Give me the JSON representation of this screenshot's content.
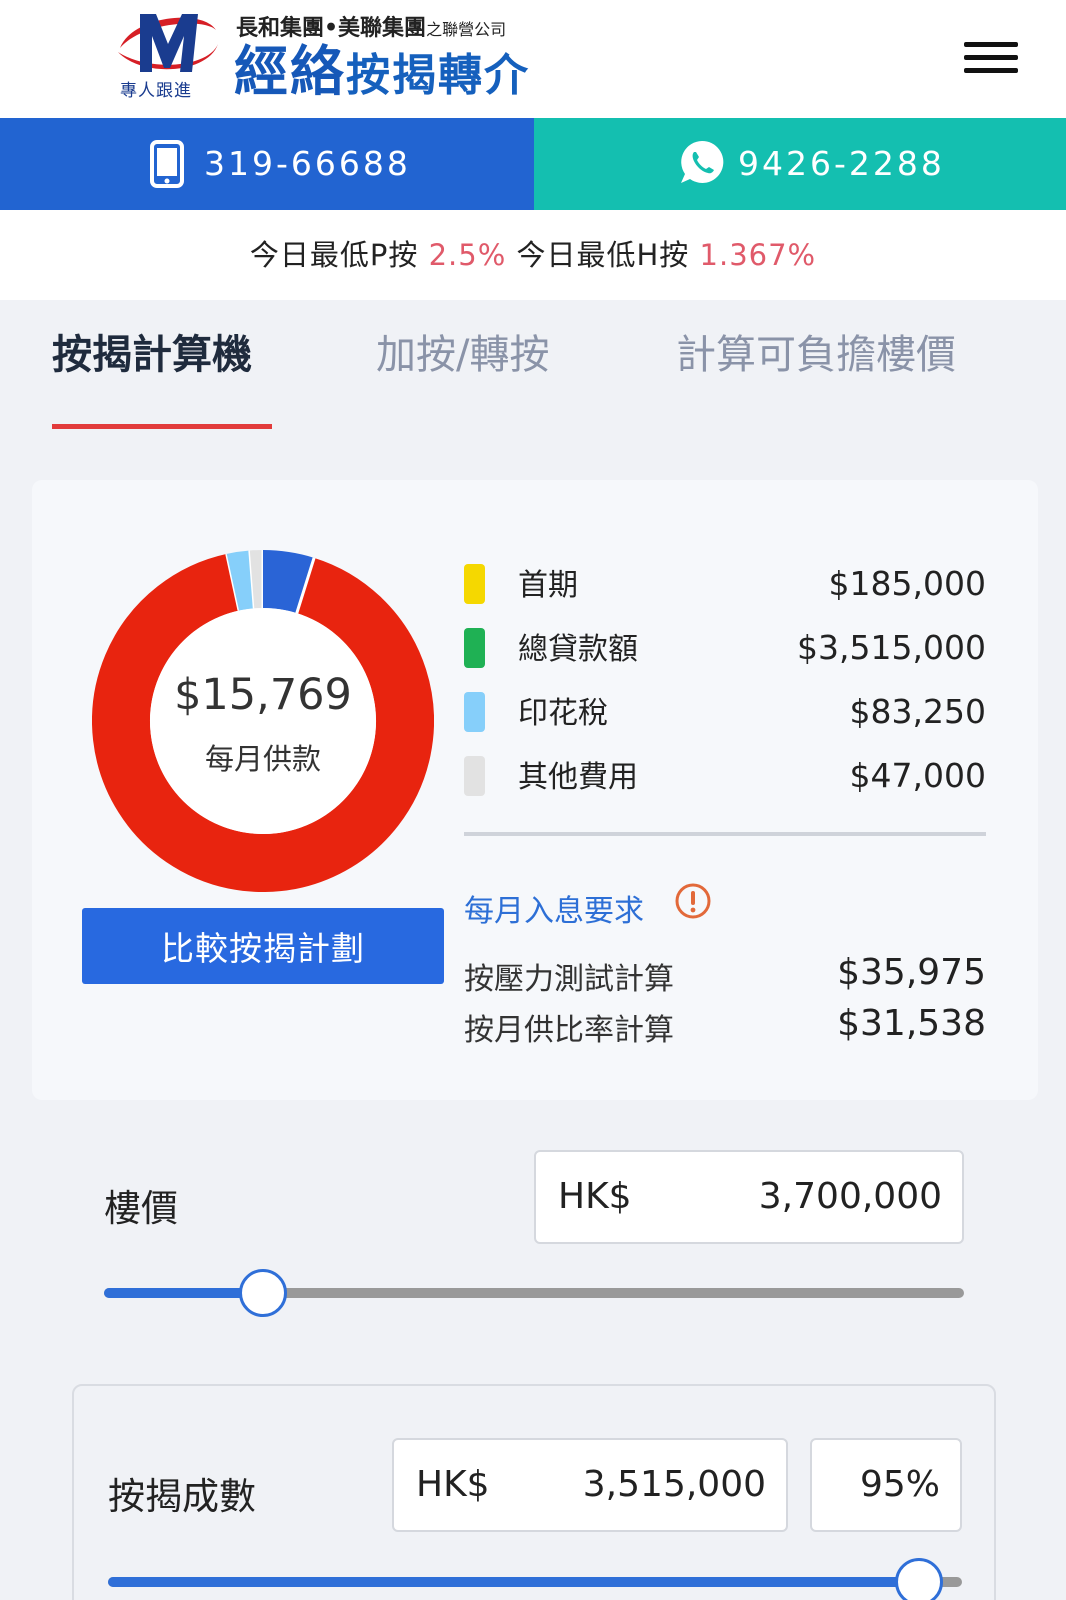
{
  "header": {
    "logo_sub": "專人跟進",
    "logo_top_main": "長和集團•美聯集團",
    "logo_top_small": "之聯營公司",
    "logo_main_big": "經絡",
    "logo_main_small": "按揭轉介",
    "menu_icon": "hamburger-icon"
  },
  "contact": {
    "phone": "319-66688",
    "whatsapp": "9426-2288"
  },
  "rates": {
    "p_label": "今日最低P按",
    "p_value": "2.5%",
    "h_label": "今日最低H按",
    "h_value": "1.367%"
  },
  "tabs": [
    {
      "label": "按揭計算機",
      "active": true
    },
    {
      "label": "加按/轉按",
      "active": false
    },
    {
      "label": "計算可負擔樓價",
      "active": false
    }
  ],
  "summary": {
    "monthly_amount": "$15,769",
    "monthly_label": "每月供款",
    "compare_button": "比較按揭計劃",
    "legend": [
      {
        "label": "首期",
        "value": "$185,000",
        "color": "#f5d800"
      },
      {
        "label": "總貸款額",
        "value": "$3,515,000",
        "color": "#1fb154"
      },
      {
        "label": "印花稅",
        "value": "$83,250",
        "color": "#86cffa"
      },
      {
        "label": "其他費用",
        "value": "$47,000",
        "color": "#e2e2e2"
      }
    ],
    "interest_title": "每月入息要求",
    "requirements": [
      {
        "label": "按壓力測試計算",
        "value": "$35,975"
      },
      {
        "label": "按月供比率計算",
        "value": "$31,538"
      }
    ],
    "donut_segments": [
      {
        "value": 3515000,
        "color": "#e8240f"
      },
      {
        "value": 83250,
        "color": "#86cffa"
      },
      {
        "value": 47000,
        "color": "#e2e2e2"
      },
      {
        "value": 185000,
        "color": "#2a64d6"
      }
    ]
  },
  "property": {
    "label": "樓價",
    "currency": "HK$",
    "value": "3,700,000",
    "slider_fraction": 0.185
  },
  "mortgage": {
    "label": "按揭成數",
    "currency": "HK$",
    "value": "3,515,000",
    "percent": "95%",
    "slider_fraction": 0.95
  },
  "colors": {
    "brand_blue": "#2264d1",
    "whatsapp_teal": "#14bfb0",
    "accent_red": "#e23b3b",
    "rate_pink": "#e05a6a"
  }
}
